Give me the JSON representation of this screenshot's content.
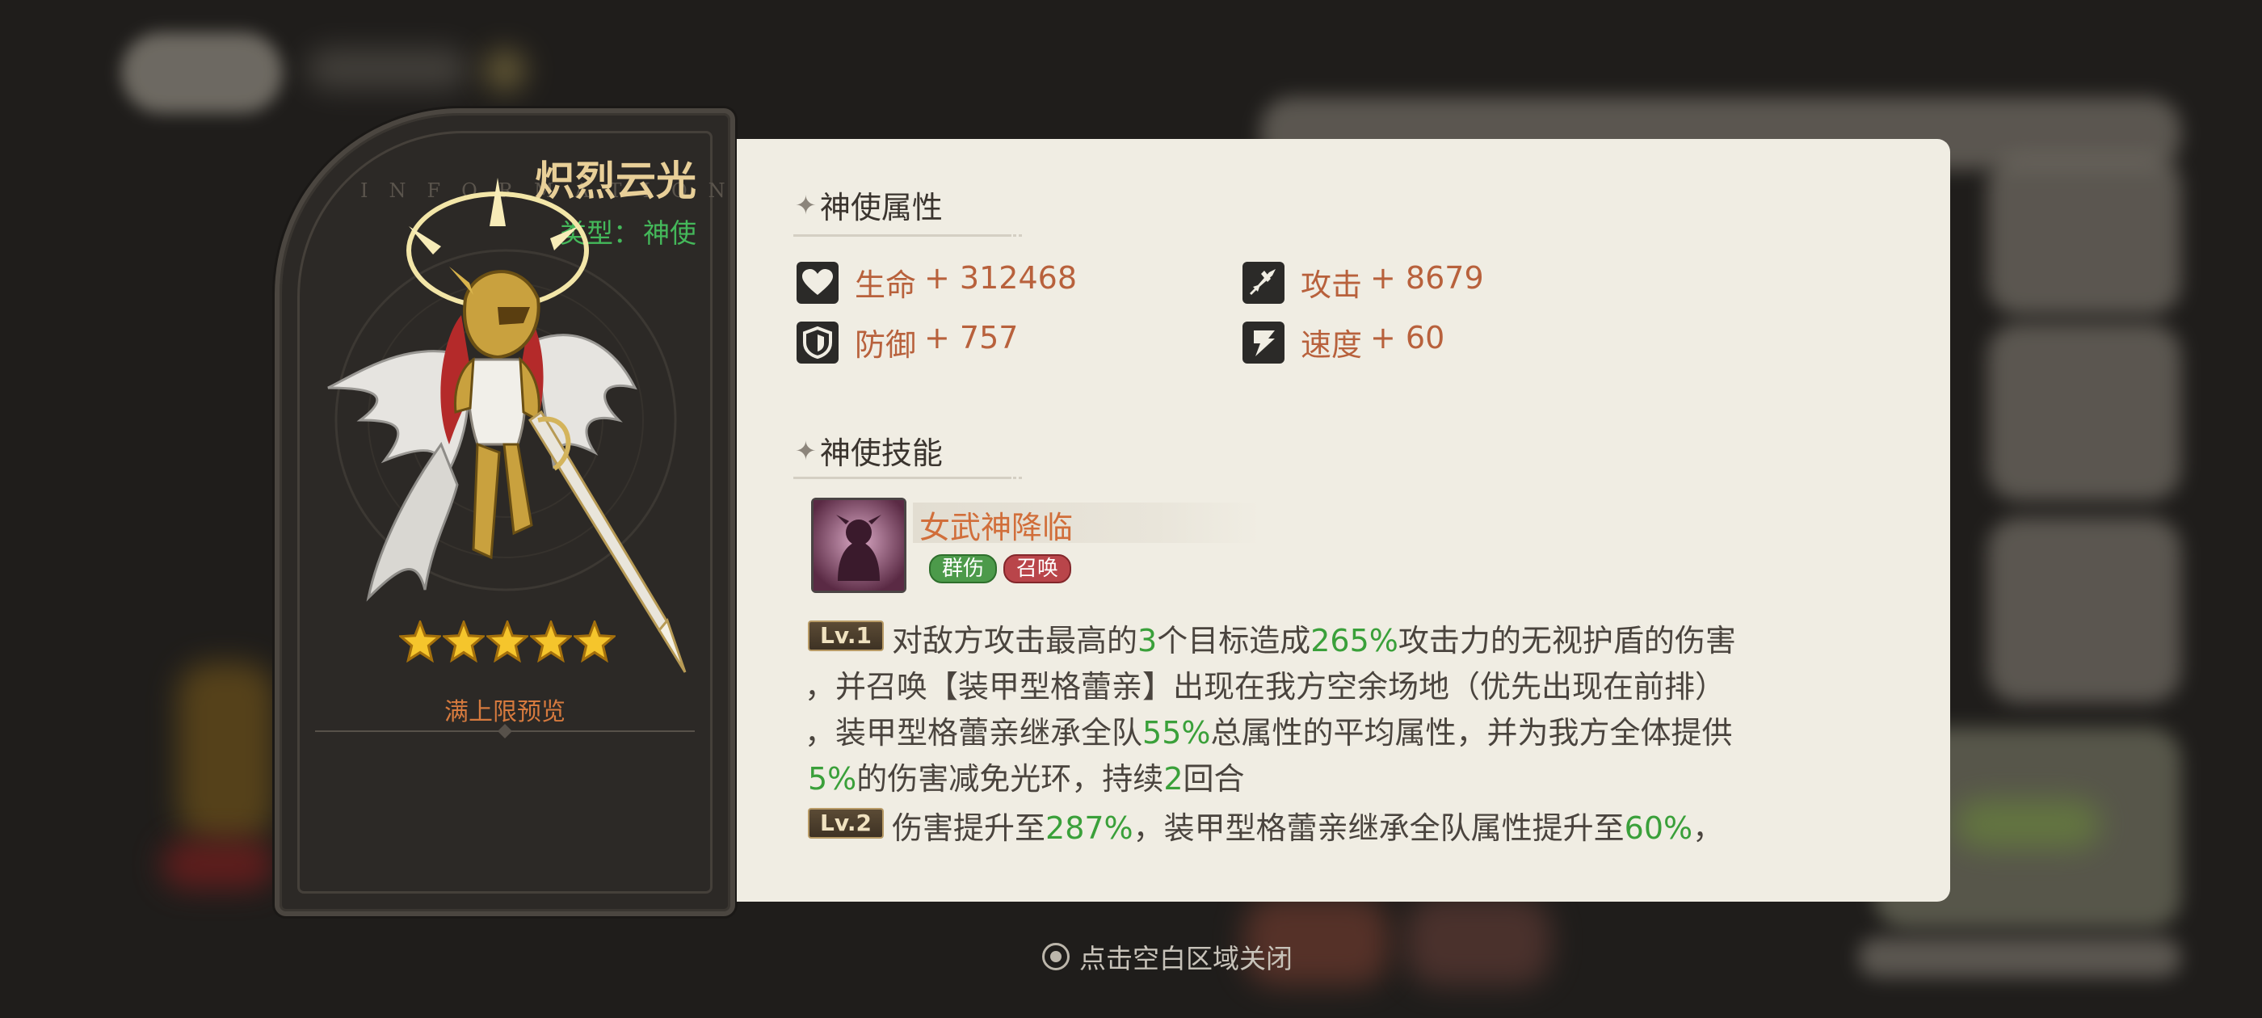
{
  "hero": {
    "watermark": "INFORMATION",
    "name": "炽烈云光",
    "type_label": "类型：",
    "type_value": "神使",
    "stars": 5,
    "preview_label": "满上限预览"
  },
  "attributes": {
    "section_title": "神使属性",
    "items": [
      {
        "icon": "heart-icon",
        "label": "生命",
        "value": "+ 312468"
      },
      {
        "icon": "sword-icon",
        "label": "攻击",
        "value": "+ 8679"
      },
      {
        "icon": "shield-icon",
        "label": "防御",
        "value": "+ 757"
      },
      {
        "icon": "speed-icon",
        "label": "速度",
        "value": "+ 60"
      }
    ]
  },
  "skills": {
    "section_title": "神使技能",
    "skill_name": "女武神降临",
    "tags": [
      "群伤",
      "召唤"
    ],
    "levels": [
      {
        "badge": "Lv.1"
      },
      {
        "badge": "Lv.2"
      }
    ],
    "lv1_line1": {
      "a": "对敌方攻击最高的",
      "n1": "3",
      "b": "个目标造成",
      "n2": "265%",
      "c": "攻击力的无视护盾的伤害"
    },
    "lv1_line2": "，并召唤【装甲型格蕾亲】出现在我方空余场地（优先出现在前排）",
    "lv1_line3": {
      "a": "，装甲型格蕾亲继承全队",
      "n1": "55%",
      "b": "总属性的平均属性，并为我方全体提供"
    },
    "lv1_line4": {
      "n1": "5%",
      "a": "的伤害减免光环，持续",
      "n2": "2",
      "b": "回合"
    },
    "lv2_line1": {
      "a": "伤害提升至",
      "n1": "287%",
      "b": "，装甲型格蕾亲继承全队属性提升至",
      "n2": "60%",
      "c": "，"
    }
  },
  "footer": {
    "close_hint": "点击空白区域关闭"
  },
  "colors": {
    "accent_orange": "#d16e3a",
    "green_value": "#3aa03a",
    "panel_bg": "#f0ede3",
    "card_bg": "#2c2926",
    "name_gold": "#e8cf98"
  }
}
